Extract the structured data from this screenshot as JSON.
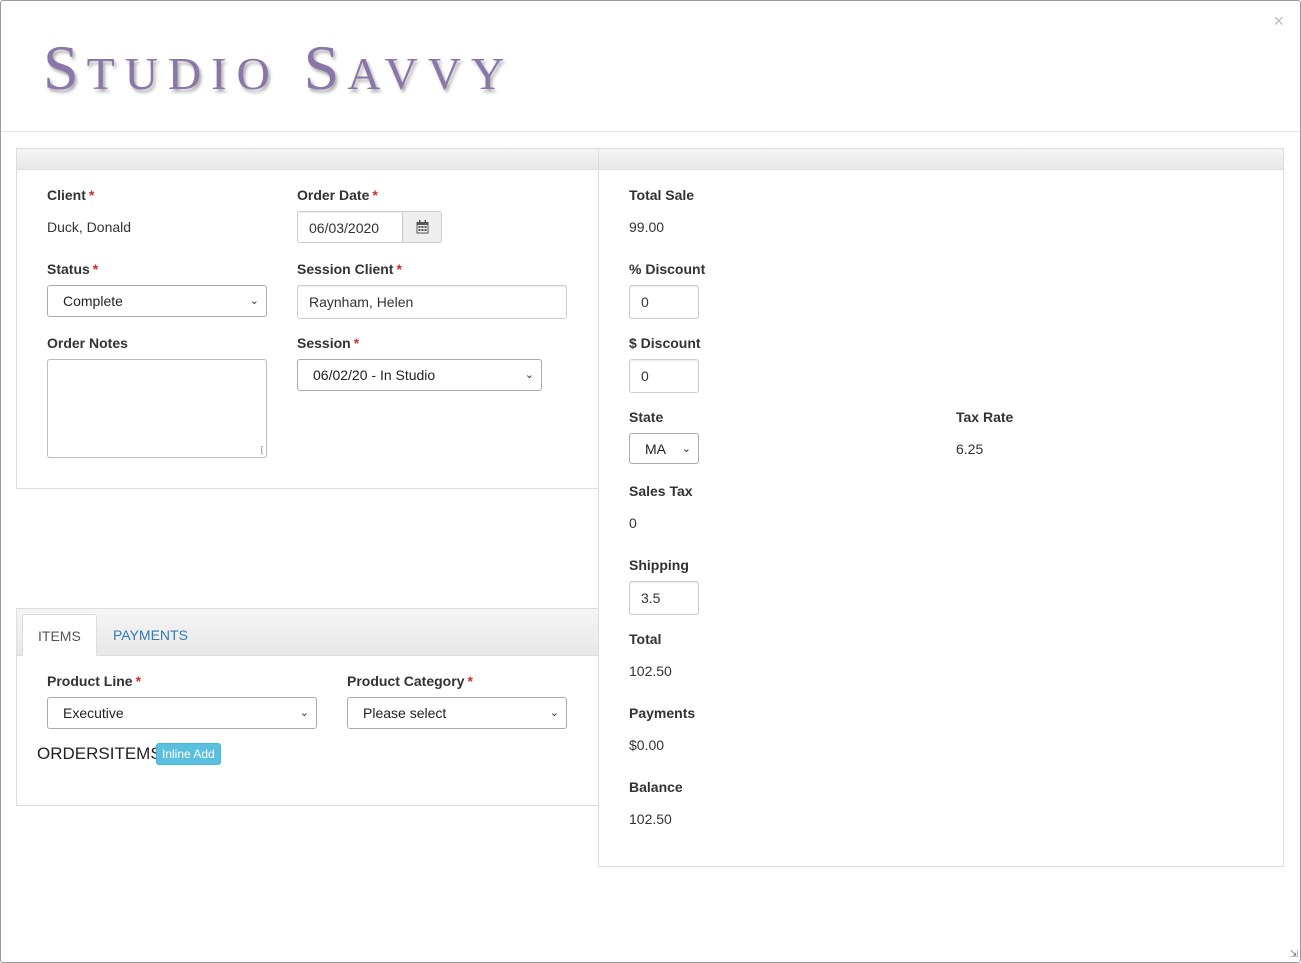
{
  "logo": {
    "s1": "S",
    "w1": "TUDIO",
    "s2": "S",
    "w2": "AVVY"
  },
  "close": "×",
  "order": {
    "client_label": "Client",
    "client_value": "Duck, Donald",
    "order_date_label": "Order Date",
    "order_date_value": "06/03/2020",
    "status_label": "Status",
    "status_value": "Complete",
    "session_client_label": "Session Client",
    "session_client_value": "Raynham, Helen",
    "notes_label": "Order Notes",
    "session_label": "Session",
    "session_value": "06/02/20 - In Studio",
    "required_mark": "*"
  },
  "tabs": {
    "items": "ITEMS",
    "payments": "PAYMENTS"
  },
  "items": {
    "product_line_label": "Product Line",
    "product_line_value": "Executive",
    "product_category_label": "Product Category",
    "product_category_value": "Please select",
    "section_title": "ORDERSITEMS",
    "inline_add": "Inline Add"
  },
  "totals": {
    "total_sale_label": "Total Sale",
    "total_sale_value": "99.00",
    "pct_discount_label": "% Discount",
    "pct_discount_value": "0",
    "dollar_discount_label": "$ Discount",
    "dollar_discount_value": "0",
    "state_label": "State",
    "state_value": "MA",
    "tax_rate_label": "Tax Rate",
    "tax_rate_value": "6.25",
    "sales_tax_label": "Sales Tax",
    "sales_tax_value": "0",
    "shipping_label": "Shipping",
    "shipping_value": "3.5",
    "total_label": "Total",
    "total_value": "102.50",
    "payments_label": "Payments",
    "payments_value": "$0.00",
    "balance_label": "Balance",
    "balance_value": "102.50"
  }
}
